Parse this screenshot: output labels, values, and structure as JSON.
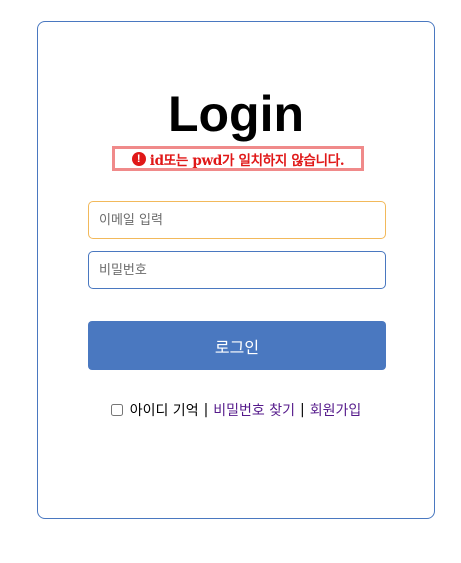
{
  "login": {
    "title": "Login",
    "error": {
      "icon": "exclamation-circle-icon",
      "icon_glyph": "!",
      "message": "id또는 pwd가 일치하지 않습니다.",
      "color": "#e01818",
      "border_color": "#f08a8a"
    },
    "email": {
      "placeholder": "이메일 입력",
      "value": ""
    },
    "password": {
      "placeholder": "비밀번호",
      "value": ""
    },
    "submit_label": "로그인",
    "remember_label": "아이디 기억",
    "remember_checked": false,
    "separator": "|",
    "find_password_label": "비밀번호 찾기",
    "signup_label": "회원가입",
    "colors": {
      "primary": "#4a78c0",
      "focus_border": "#f2b95b",
      "visited_link": "#551a8b"
    }
  }
}
